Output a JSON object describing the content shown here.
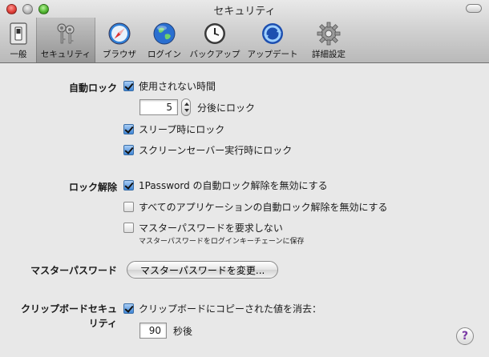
{
  "window": {
    "title": "セキュリティ"
  },
  "toolbar": {
    "items": [
      {
        "label": "一般",
        "icon": "general-switch-icon"
      },
      {
        "label": "セキュリティ",
        "icon": "keys-icon"
      },
      {
        "label": "ブラウザ",
        "icon": "compass-icon"
      },
      {
        "label": "ログイン",
        "icon": "globe-icon"
      },
      {
        "label": "バックアップ",
        "icon": "clock-icon"
      },
      {
        "label": "アップデート",
        "icon": "refresh-icon"
      },
      {
        "label": "詳細設定",
        "icon": "gear-icon"
      }
    ],
    "selected": "セキュリティ"
  },
  "autolock": {
    "label": "自動ロック",
    "idle_label": "使用されない時間",
    "minutes_value": "5",
    "minutes_suffix": "分後にロック",
    "sleep_label": "スリープ時にロック",
    "screensaver_label": "スクリーンセーバー実行時にロック"
  },
  "unlock": {
    "label": "ロック解除",
    "opt1_label": "1Password の自動ロック解除を無効にする",
    "opt2_label": "すべてのアプリケーションの自動ロック解除を無効にする",
    "opt3_label": "マスターパスワードを要求しない",
    "opt3_note": "マスターパスワードをログインキーチェーンに保存"
  },
  "master": {
    "label": "マスターパスワード",
    "button_label": "マスターパスワードを変更..."
  },
  "clipboard": {
    "label_line1": "クリップボードセキュ",
    "label_line2": "リティ",
    "clear_label": "クリップボードにコピーされた値を消去：",
    "seconds_value": "90",
    "seconds_suffix": "秒後"
  },
  "help": {
    "label": "?"
  },
  "colors": {
    "accent": "#3f86d6",
    "help_glyph": "#7a3aa5"
  }
}
